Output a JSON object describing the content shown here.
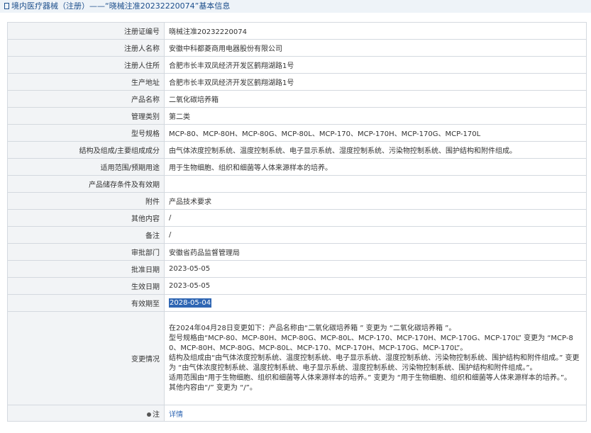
{
  "header": {
    "title": "境内医疗器械（注册）——“晓械注准20232220074”基本信息"
  },
  "fields": [
    {
      "label": "注册证编号",
      "value": "晓械注准20232220074"
    },
    {
      "label": "注册人名称",
      "value": "安徽中科都菱商用电器股份有限公司"
    },
    {
      "label": "注册人住所",
      "value": "合肥市长丰双凤经济开发区鹤翔湖路1号"
    },
    {
      "label": "生产地址",
      "value": "合肥市长丰双凤经济开发区鹤翔湖路1号"
    },
    {
      "label": "产品名称",
      "value": "二氧化碳培养箱"
    },
    {
      "label": "管理类别",
      "value": "第二类"
    },
    {
      "label": "型号规格",
      "value": "MCP-80、MCP-80H、MCP-80G、MCP-80L、MCP-170、MCP-170H、MCP-170G、MCP-170L"
    },
    {
      "label": "结构及组成/主要组成成分",
      "value": "由气体浓度控制系统、温度控制系统、电子显示系统、湿度控制系统、污染物控制系统、围护结构和附件组成。"
    },
    {
      "label": "适用范围/预期用途",
      "value": "用于生物细胞、组织和细菌等人体来源样本的培养。"
    },
    {
      "label": "产品储存条件及有效期",
      "value": ""
    },
    {
      "label": "附件",
      "value": "产品技术要求"
    },
    {
      "label": "其他内容",
      "value": "/"
    },
    {
      "label": "备注",
      "value": "/"
    },
    {
      "label": "审批部门",
      "value": "安徽省药品监督管理局"
    },
    {
      "label": "批准日期",
      "value": "2023-05-05"
    },
    {
      "label": "生效日期",
      "value": "2023-05-05"
    },
    {
      "label": "有效期至",
      "value": "2028-05-04"
    }
  ],
  "change": {
    "label": "变更情况",
    "lines": [
      "在2024年04月28日变更如下：产品名称由“二氧化碳培养箱 ” 变更为 “二氧化碳培养箱 ”。",
      "型号规格由“MCP-80、MCP-80H、MCP-80G、MCP-80L、MCP-170、MCP-170H、MCP-170G、MCP-170L” 变更为 “MCP-80、MCP-80H、MCP-80G、MCP-80L、MCP-170、MCP-170H、MCP-170G、MCP-170L”。",
      "结构及组成由“由气体浓度控制系统、温度控制系统、电子显示系统、湿度控制系统、污染物控制系统、围护结构和附件组成。” 变更为 “由气体浓度控制系统、温度控制系统、电子显示系统、湿度控制系统、污染物控制系统、围护结构和附件组成。”。",
      "适用范围由“用于生物细胞、组织和细菌等人体来源样本的培养。” 变更为 “用于生物细胞、组织和细菌等人体来源样本的培养。”。",
      "其他内容由“/” 变更为 “/”。"
    ]
  },
  "note": {
    "label": "注",
    "link": "详情"
  }
}
